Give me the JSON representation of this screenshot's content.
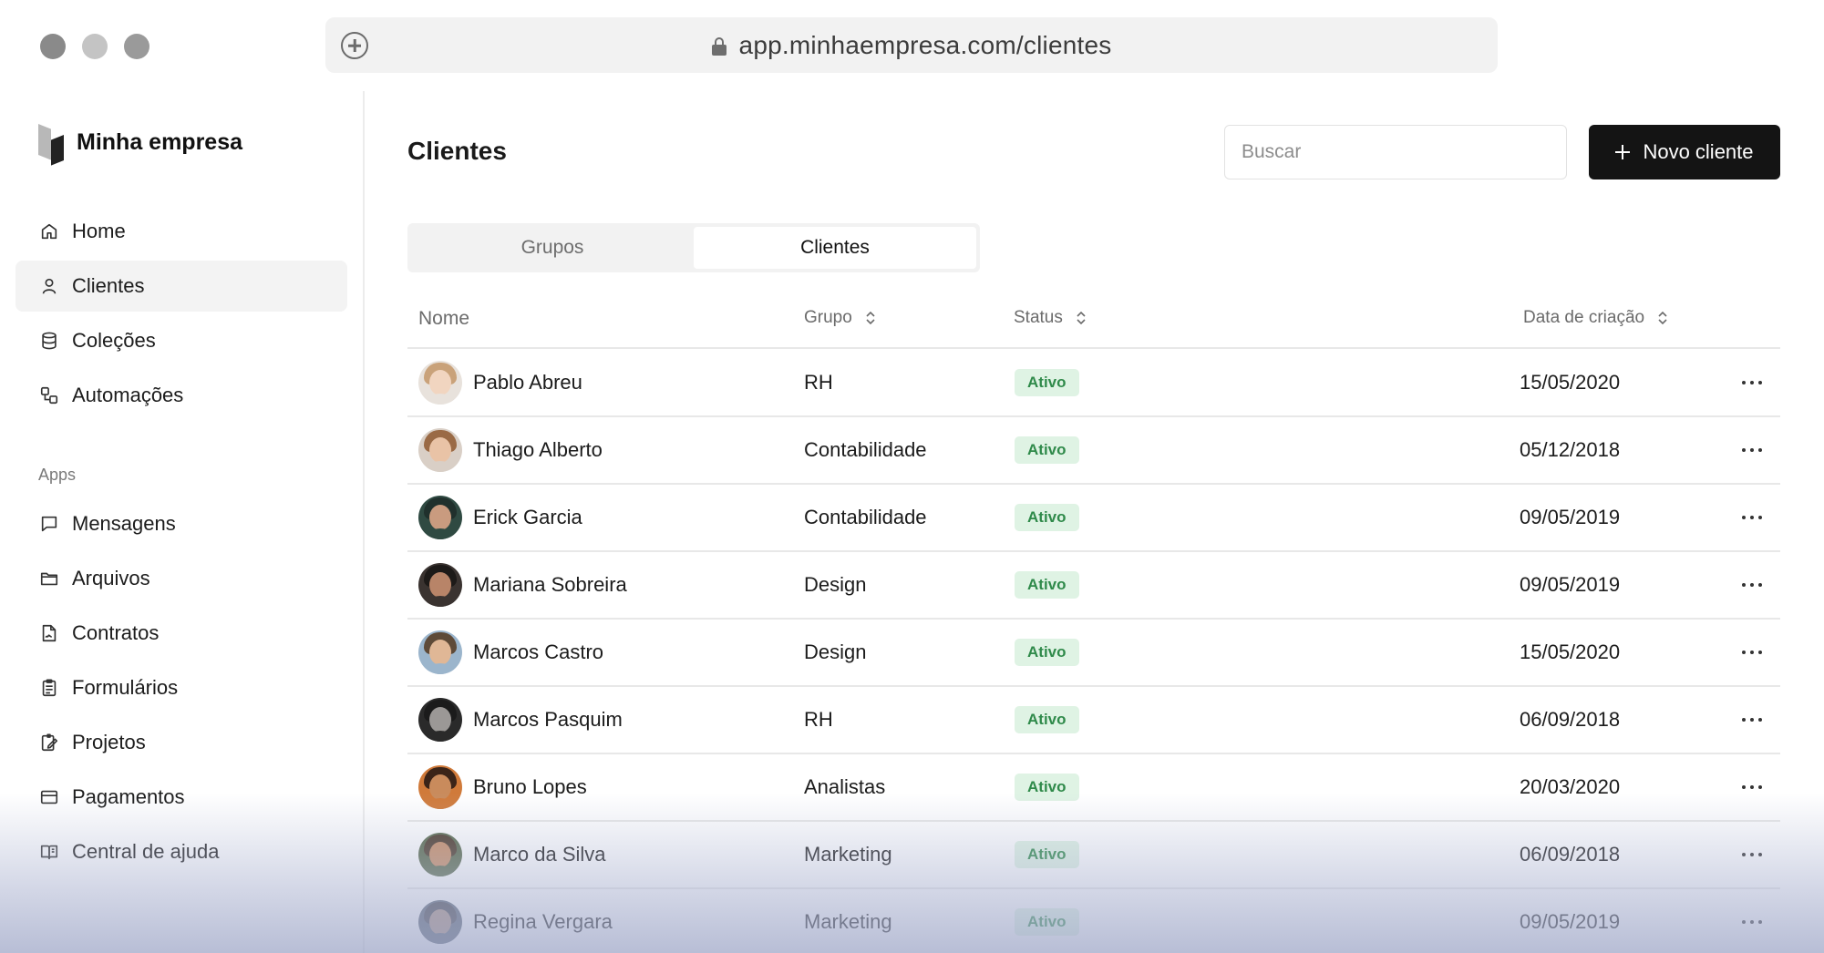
{
  "browser": {
    "url": "app.minhaempresa.com/clientes"
  },
  "sidebar": {
    "brand": "Minha empresa",
    "main_items": [
      {
        "label": "Home",
        "icon": "home-icon"
      },
      {
        "label": "Clientes",
        "icon": "user-icon",
        "active": true
      },
      {
        "label": "Coleções",
        "icon": "database-icon"
      },
      {
        "label": "Automações",
        "icon": "automation-icon"
      }
    ],
    "apps_label": "Apps",
    "app_items": [
      {
        "label": "Mensagens",
        "icon": "message-icon"
      },
      {
        "label": "Arquivos",
        "icon": "folder-icon"
      },
      {
        "label": "Contratos",
        "icon": "contract-icon"
      },
      {
        "label": "Formulários",
        "icon": "clipboard-icon"
      },
      {
        "label": "Projetos",
        "icon": "project-icon"
      },
      {
        "label": "Pagamentos",
        "icon": "credit-card-icon"
      },
      {
        "label": "Central de ajuda",
        "icon": "help-book-icon"
      }
    ]
  },
  "main": {
    "title": "Clientes",
    "search_placeholder": "Buscar",
    "new_button": "Novo cliente",
    "tabs": [
      {
        "label": "Grupos",
        "active": false
      },
      {
        "label": "Clientes",
        "active": true
      }
    ],
    "columns": {
      "name": "Nome",
      "group": "Grupo",
      "status": "Status",
      "date": "Data de criação"
    },
    "rows": [
      {
        "name": "Pablo Abreu",
        "group": "RH",
        "status": "Ativo",
        "date": "15/05/2020"
      },
      {
        "name": "Thiago Alberto",
        "group": "Contabilidade",
        "status": "Ativo",
        "date": "05/12/2018"
      },
      {
        "name": "Erick Garcia",
        "group": "Contabilidade",
        "status": "Ativo",
        "date": "09/05/2019"
      },
      {
        "name": "Mariana Sobreira",
        "group": "Design",
        "status": "Ativo",
        "date": "09/05/2019"
      },
      {
        "name": "Marcos Castro",
        "group": "Design",
        "status": "Ativo",
        "date": "15/05/2020"
      },
      {
        "name": "Marcos Pasquim",
        "group": "RH",
        "status": "Ativo",
        "date": "06/09/2018"
      },
      {
        "name": "Bruno Lopes",
        "group": "Analistas",
        "status": "Ativo",
        "date": "20/03/2020"
      },
      {
        "name": "Marco da Silva",
        "group": "Marketing",
        "status": "Ativo",
        "date": "06/09/2018"
      },
      {
        "name": "Regina Vergara",
        "group": "Marketing",
        "status": "Ativo",
        "date": "09/05/2019"
      }
    ]
  },
  "colors": {
    "primary_button": "#141414",
    "status_bg": "#dff3e4",
    "status_text": "#2f8a4a",
    "active_nav_bg": "#f3f3f3"
  }
}
